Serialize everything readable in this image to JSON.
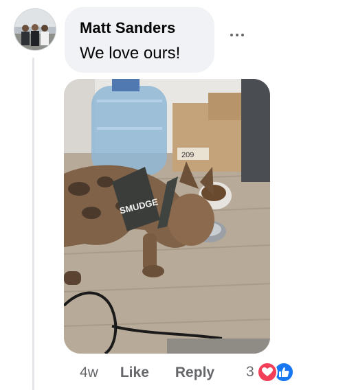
{
  "comment": {
    "author": "Matt Sanders",
    "text": "We love ours!",
    "timestamp": "4w",
    "like_label": "Like",
    "reply_label": "Reply",
    "reaction_count": "3",
    "reactions": [
      "love-icon",
      "like-icon"
    ]
  },
  "photo": {
    "harness_text": "SMUDGE",
    "box_label": "209"
  },
  "colors": {
    "bubble": "#f0f2f5",
    "meta_text": "#65676b",
    "love": "#f33e58",
    "like": "#1877f2"
  }
}
